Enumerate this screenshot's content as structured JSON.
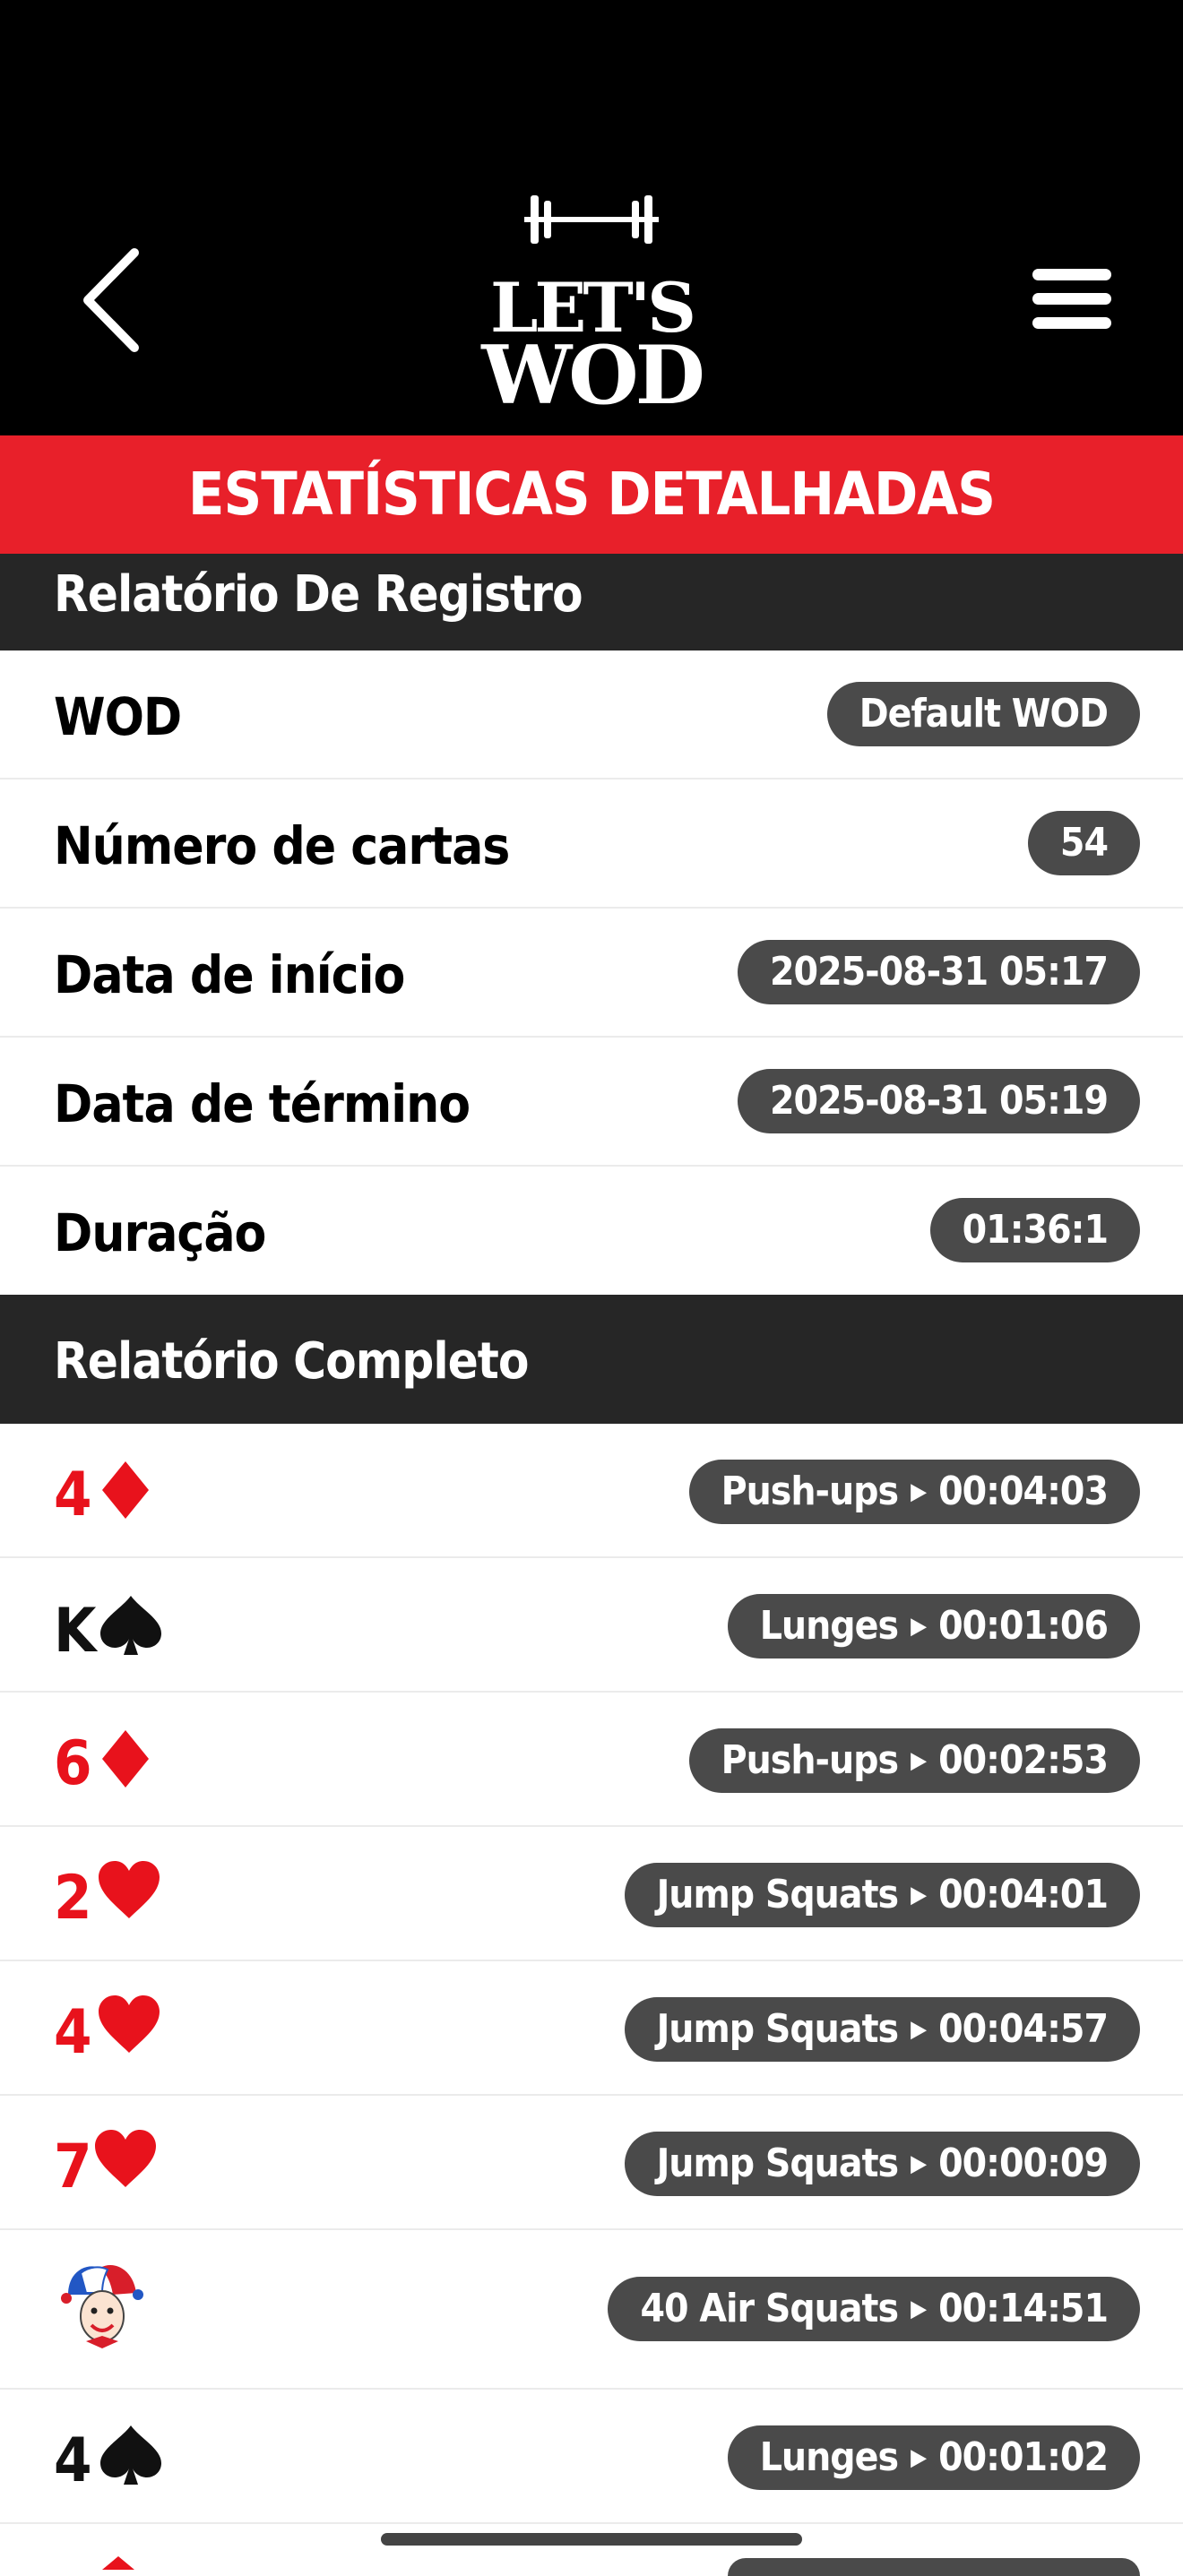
{
  "header": {
    "logo_line1": "LET'S",
    "logo_line2": "WOD"
  },
  "banner": {
    "title": "ESTATÍSTICAS DETALHADAS"
  },
  "registro": {
    "heading": "Relatório De Registro",
    "rows": [
      {
        "label": "WOD",
        "value": "Default WOD"
      },
      {
        "label": "Número de cartas",
        "value": "54"
      },
      {
        "label": "Data de início",
        "value": "2025-08-31 05:17"
      },
      {
        "label": "Data de término",
        "value": "2025-08-31 05:19"
      },
      {
        "label": "Duração",
        "value": "01:36:1"
      }
    ]
  },
  "completo": {
    "heading": "Relatório Completo",
    "cards": [
      {
        "rank": "4",
        "suit": "diamond",
        "color": "#e8121c",
        "exercise": "Push-ups",
        "time": "00:04:03"
      },
      {
        "rank": "K",
        "suit": "spade",
        "color": "#111111",
        "exercise": "Lunges",
        "time": "00:01:06"
      },
      {
        "rank": "6",
        "suit": "diamond",
        "color": "#e8121c",
        "exercise": "Push-ups",
        "time": "00:02:53"
      },
      {
        "rank": "2",
        "suit": "heart",
        "color": "#e8121c",
        "exercise": "Jump Squats",
        "time": "00:04:01"
      },
      {
        "rank": "4",
        "suit": "heart",
        "color": "#e8121c",
        "exercise": "Jump Squats",
        "time": "00:04:57"
      },
      {
        "rank": "7",
        "suit": "heart",
        "color": "#e8121c",
        "exercise": "Jump Squats",
        "time": "00:00:09"
      },
      {
        "rank": "",
        "suit": "joker",
        "color": "#e8121c",
        "exercise": "40 Air Squats",
        "time": "00:14:51"
      },
      {
        "rank": "4",
        "suit": "spade",
        "color": "#111111",
        "exercise": "Lunges",
        "time": "00:01:02"
      }
    ]
  },
  "colors": {
    "accent_red": "#e8202a",
    "section_bg": "#262626",
    "pill_bg": "#4a4a4a"
  }
}
